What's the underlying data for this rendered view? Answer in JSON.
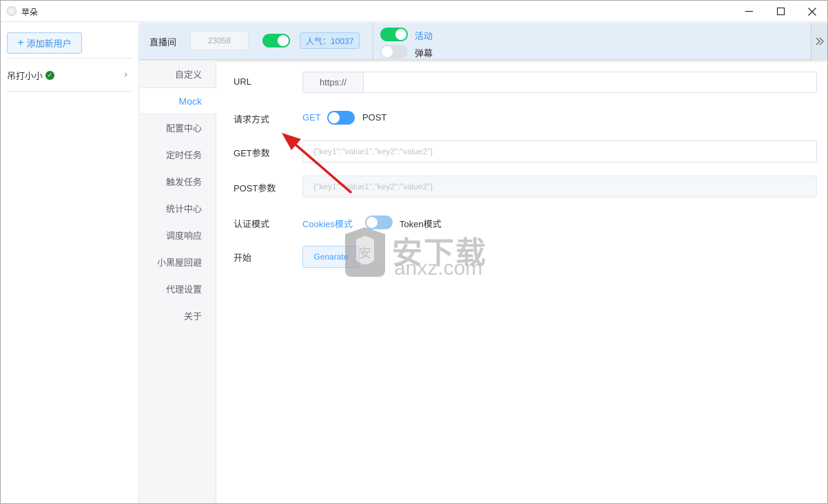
{
  "window": {
    "title": "苹朵",
    "controls": [
      "minimize",
      "maximize",
      "close"
    ]
  },
  "user_panel": {
    "add_user_label": "添加新用户",
    "users": [
      {
        "name": "吊打小小",
        "status": "verified"
      }
    ]
  },
  "topbar": {
    "room_label": "直播间",
    "room_number": "23058",
    "room_toggle_on": true,
    "popularity": "人气：10037",
    "activity_label": "活动",
    "activity_on": true,
    "danmu_label": "弹幕",
    "danmu_on": false
  },
  "nav": {
    "items": [
      "自定义",
      "Mock",
      "配置中心",
      "定时任务",
      "触发任务",
      "统计中心",
      "调度响应",
      "小黑屋回避",
      "代理设置",
      "关于"
    ],
    "active": "Mock"
  },
  "form": {
    "url_label": "URL",
    "url_prefix": "https://",
    "url_value": "",
    "method_label": "请求方式",
    "method_left": "GET",
    "method_right": "POST",
    "method_selected": "GET",
    "get_params_label": "GET参数",
    "get_params_placeholder": "{\"key1\":\"value1\",\"key2\":\"value2\"}",
    "post_params_label": "POST参数",
    "post_params_placeholder": "{\"key1\":\"value1\",\"key2\":\"value2\"}",
    "post_params_disabled": true,
    "auth_label": "认证模式",
    "auth_left": "Cookies模式",
    "auth_right": "Token模式",
    "auth_selected": "Cookies模式",
    "start_label": "开始",
    "generate_button": "Genarate"
  },
  "watermark": {
    "shield_char": "安",
    "text": "安下载",
    "sub": "anxz.com"
  },
  "colors": {
    "accent": "#409eff",
    "toggle_green": "#13ce66",
    "annotation_arrow": "#d9201f"
  }
}
